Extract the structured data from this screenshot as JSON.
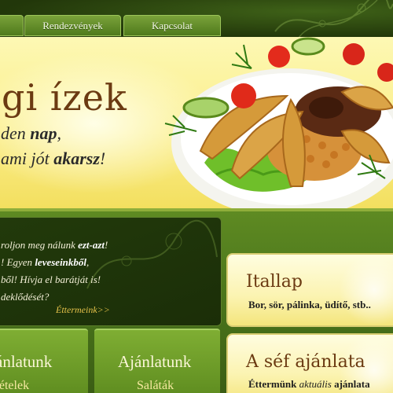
{
  "nav": {
    "tabs": [
      {
        "label": ""
      },
      {
        "label": "Rendezvények"
      },
      {
        "label": "Kapcsolat"
      }
    ]
  },
  "hero": {
    "title": "gi ízek",
    "line1": {
      "prefix": "den ",
      "bold": "nap",
      "suffix": ","
    },
    "line2": {
      "prefix": "ami jót ",
      "bold": "akarsz",
      "suffix": "!"
    },
    "image": "food-plate"
  },
  "info": {
    "lines": [
      {
        "prefix": "roljon meg nálunk ",
        "bold": "ezt-azt",
        "suffix": "!"
      },
      {
        "prefix": "! Egyen ",
        "bold": "leveseinkből",
        "suffix": ","
      },
      {
        "prefix": "ből! Hívja el barátját is!",
        "bold": "",
        "suffix": ""
      },
      {
        "prefix": "deklődését?",
        "bold": "",
        "suffix": ""
      }
    ],
    "link": "Éttermeink>>"
  },
  "recommendations": [
    {
      "title": "ánlatunk",
      "subtitle": "' ételek"
    },
    {
      "title": "Ajánlatunk",
      "subtitle": "Saláták"
    }
  ],
  "cards": [
    {
      "title": "Itallap",
      "text_prefix": "Bor, sör, pálinka, üdítő, stb..",
      "text_italic": "",
      "text_suffix": ""
    },
    {
      "title": "A séf ajánlata",
      "text_prefix": "Éttermünk ",
      "text_italic": "aktuális",
      "text_suffix": " ajánlata"
    }
  ],
  "colors": {
    "dark_green": "#22370a",
    "accent_green": "#6a9a2a",
    "banner_yellow": "#fbee8a",
    "title_brown": "#6b3a12",
    "link_gold": "#e6c24a"
  }
}
